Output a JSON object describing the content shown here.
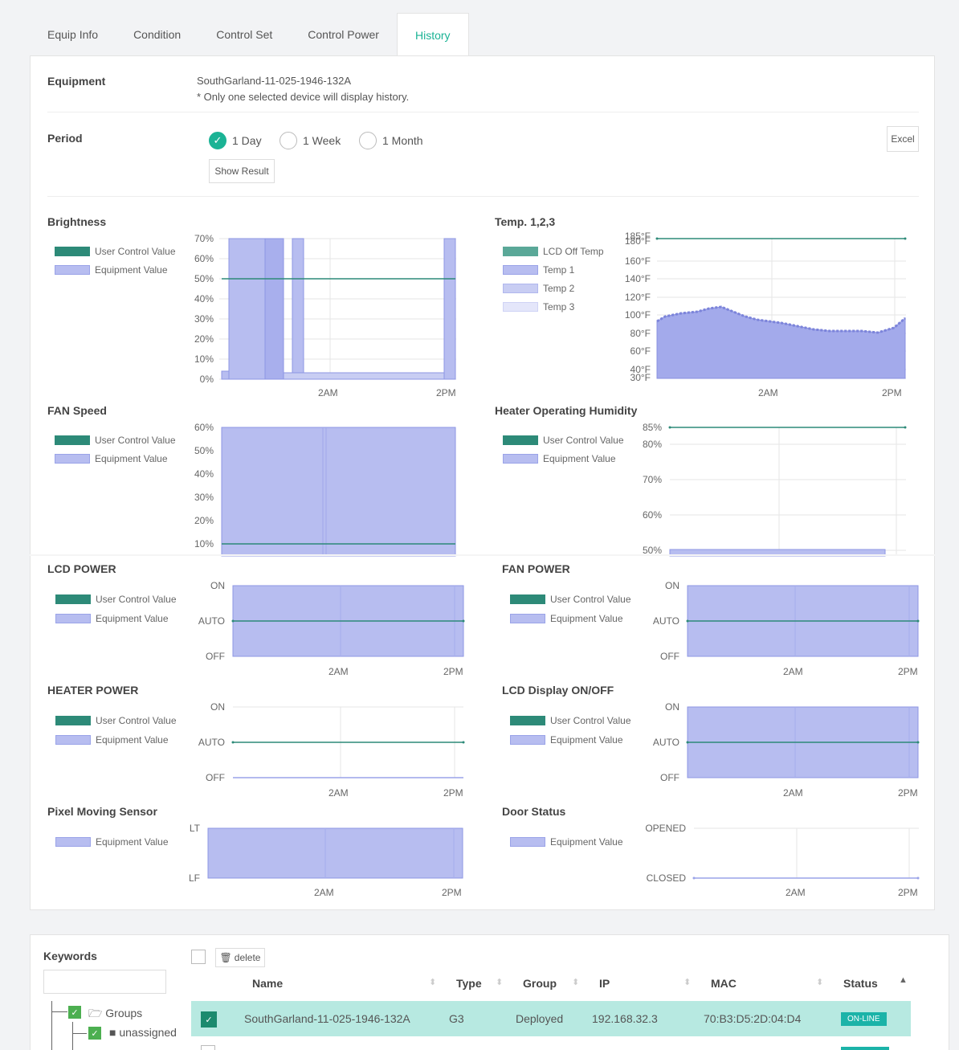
{
  "tabs": [
    "Equip Info",
    "Condition",
    "Control Set",
    "Control Power",
    "History"
  ],
  "equipment": {
    "label": "Equipment",
    "name": "SouthGarland-11-025-1946-132A",
    "note": "* Only one selected device will display history."
  },
  "period": {
    "label": "Period",
    "options": [
      "1 Day",
      "1 Week",
      "1 Month"
    ],
    "selected": "1 Day",
    "show_result": "Show Result",
    "excel": "Excel"
  },
  "legend_labels": {
    "user": "User Control Value",
    "equip": "Equipment Value",
    "lcd_off": "LCD Off Temp",
    "t1": "Temp 1",
    "t2": "Temp 2",
    "t3": "Temp 3"
  },
  "charts": {
    "brightness": {
      "title": "Brightness"
    },
    "temp": {
      "title": "Temp. 1,2,3"
    },
    "fan_speed": {
      "title": "FAN Speed"
    },
    "heater_humidity": {
      "title": "Heater Operating Humidity"
    },
    "lcd_power": {
      "title": "LCD POWER"
    },
    "fan_power": {
      "title": "FAN POWER"
    },
    "heater_power": {
      "title": "HEATER POWER"
    },
    "lcd_display": {
      "title": "LCD Display ON/OFF"
    },
    "pixel_sensor": {
      "title": "Pixel Moving Sensor"
    },
    "door_status": {
      "title": "Door Status"
    }
  },
  "chart_data": [
    {
      "type": "area",
      "title": "Brightness",
      "x_ticks": [
        "2AM",
        "2PM"
      ],
      "y_ticks": [
        "0%",
        "10%",
        "20%",
        "30%",
        "40%",
        "50%",
        "60%",
        "70%"
      ],
      "ylim": [
        0,
        70
      ],
      "series": [
        {
          "name": "User Control Value",
          "values": [
            50,
            50
          ]
        },
        {
          "name": "Equipment Value",
          "values": [
            3,
            70,
            70,
            2,
            70,
            2,
            2,
            2,
            70
          ]
        }
      ]
    },
    {
      "type": "area",
      "title": "Temp. 1,2,3",
      "x_ticks": [
        "2AM",
        "2PM"
      ],
      "y_ticks": [
        "30°F",
        "40°F",
        "60°F",
        "80°F",
        "100°F",
        "120°F",
        "140°F",
        "160°F",
        "180°F",
        "185°F"
      ],
      "ylim": [
        30,
        185
      ],
      "series": [
        {
          "name": "LCD Off Temp",
          "values": [
            185,
            185
          ]
        },
        {
          "name": "Temp 1",
          "values": [
            95,
            105,
            110,
            100,
            95,
            88,
            85,
            85,
            85,
            100
          ]
        }
      ]
    },
    {
      "type": "area",
      "title": "FAN Speed",
      "y_ticks": [
        "10%",
        "20%",
        "30%",
        "40%",
        "50%",
        "60%"
      ],
      "ylim": [
        10,
        60
      ],
      "series": [
        {
          "name": "User Control Value",
          "values": [
            10,
            10
          ]
        },
        {
          "name": "Equipment Value",
          "values": [
            60,
            60
          ]
        }
      ]
    },
    {
      "type": "line",
      "title": "Heater Operating Humidity",
      "y_ticks": [
        "50%",
        "60%",
        "70%",
        "80%",
        "85%"
      ],
      "ylim": [
        50,
        85
      ],
      "series": [
        {
          "name": "User Control Value",
          "values": [
            85,
            85
          ]
        },
        {
          "name": "Equipment Value",
          "values": [
            50,
            50
          ]
        }
      ]
    },
    {
      "type": "area",
      "title": "LCD POWER",
      "x_ticks": [
        "2AM",
        "2PM"
      ],
      "y_ticks": [
        "OFF",
        "AUTO",
        "ON"
      ],
      "series": [
        {
          "name": "User Control Value",
          "values": [
            "AUTO",
            "AUTO"
          ]
        },
        {
          "name": "Equipment Value",
          "values": [
            "ON",
            "ON"
          ]
        }
      ]
    },
    {
      "type": "area",
      "title": "FAN POWER",
      "x_ticks": [
        "2AM",
        "2PM"
      ],
      "y_ticks": [
        "OFF",
        "AUTO",
        "ON"
      ],
      "series": [
        {
          "name": "User Control Value",
          "values": [
            "AUTO",
            "AUTO"
          ]
        },
        {
          "name": "Equipment Value",
          "values": [
            "ON",
            "ON"
          ]
        }
      ]
    },
    {
      "type": "line",
      "title": "HEATER POWER",
      "x_ticks": [
        "2AM",
        "2PM"
      ],
      "y_ticks": [
        "OFF",
        "AUTO",
        "ON"
      ],
      "series": [
        {
          "name": "User Control Value",
          "values": [
            "AUTO",
            "AUTO"
          ]
        },
        {
          "name": "Equipment Value",
          "values": [
            "OFF",
            "OFF"
          ]
        }
      ]
    },
    {
      "type": "area",
      "title": "LCD Display ON/OFF",
      "x_ticks": [
        "2AM",
        "2PM"
      ],
      "y_ticks": [
        "OFF",
        "AUTO",
        "ON"
      ],
      "series": [
        {
          "name": "User Control Value",
          "values": [
            "AUTO",
            "AUTO"
          ]
        },
        {
          "name": "Equipment Value",
          "values": [
            "ON",
            "ON"
          ]
        }
      ]
    },
    {
      "type": "area",
      "title": "Pixel Moving Sensor",
      "x_ticks": [
        "2AM",
        "2PM"
      ],
      "y_ticks": [
        "LF",
        "LT"
      ],
      "series": [
        {
          "name": "Equipment Value",
          "values": [
            "LT",
            "LT"
          ]
        }
      ]
    },
    {
      "type": "line",
      "title": "Door Status",
      "x_ticks": [
        "2AM",
        "2PM"
      ],
      "y_ticks": [
        "CLOSED",
        "OPENED"
      ],
      "series": [
        {
          "name": "Equipment Value",
          "values": [
            "CLOSED",
            "CLOSED"
          ]
        }
      ]
    }
  ],
  "bottom": {
    "keywords_label": "Keywords",
    "delete_label": "delete",
    "columns": [
      "Name",
      "Type",
      "Group",
      "IP",
      "MAC",
      "Status"
    ],
    "tree": {
      "groups": "Groups",
      "unassigned": "unassigned"
    },
    "row": {
      "name": "SouthGarland-11-025-1946-132A",
      "type": "G3",
      "group": "Deployed",
      "ip": "192.168.32.3",
      "mac": "70:B3:D5:2D:04:D4",
      "status": "ON-LINE"
    }
  },
  "colors": {
    "accent": "#1bb395",
    "user_line": "#2d8a78",
    "equip_fill": "#b7bdf0"
  }
}
